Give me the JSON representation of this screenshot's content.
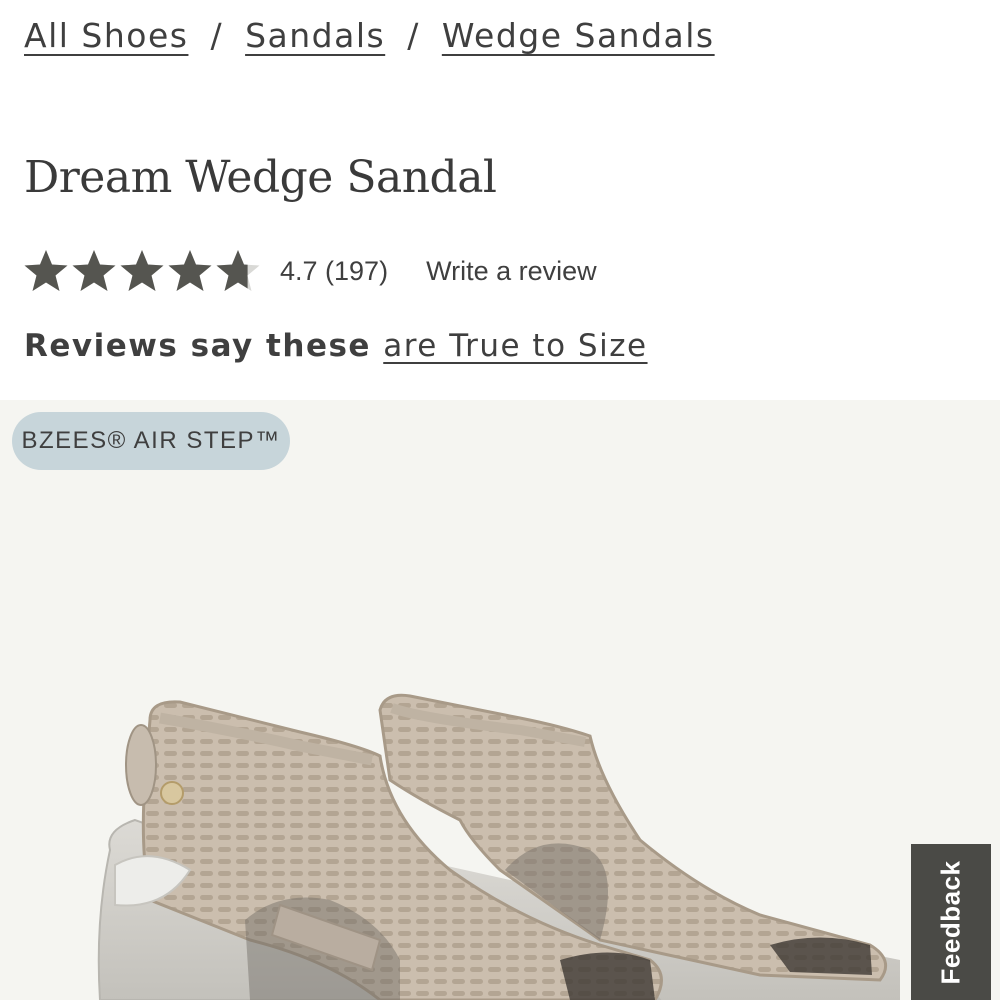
{
  "breadcrumb": {
    "items": [
      {
        "label": "All Shoes"
      },
      {
        "label": "Sandals"
      },
      {
        "label": "Wedge Sandals"
      }
    ],
    "separator": "/"
  },
  "product": {
    "title": "Dream Wedge Sandal",
    "rating_value": 4.7,
    "rating_max": 5,
    "rating_text": "4.7 (197)",
    "write_review_label": "Write a review",
    "fit_summary_prefix": "Reviews say these",
    "fit_summary_link": "are True to Size"
  },
  "image": {
    "brand_badge": "BZEES® AIR STEP™",
    "subject": "Pair of taupe mesh wedge sandals"
  },
  "feedback_tab": {
    "label": "Feedback"
  },
  "colors": {
    "text": "#3f3f3f",
    "star": "#555550",
    "badge_bg": "#c7d5da",
    "image_bg": "#f5f5f1",
    "feedback_bg": "#4a4a46"
  },
  "icons": {
    "rating_star": "star-icon"
  }
}
